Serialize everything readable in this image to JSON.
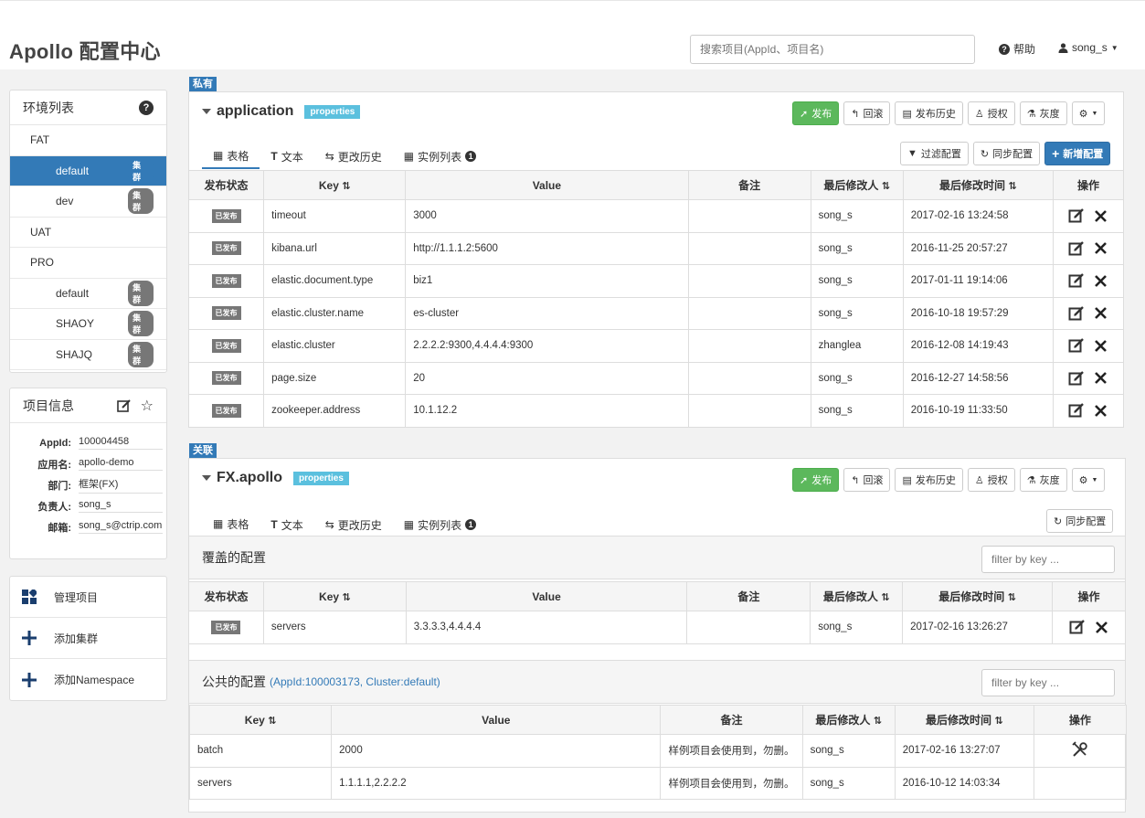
{
  "header": {
    "brand": "Apollo 配置中心",
    "search_placeholder": "搜索项目(AppId、项目名)",
    "help": "帮助",
    "user": "song_s"
  },
  "env_panel": {
    "title": "环境列表",
    "items": [
      {
        "type": "env",
        "label": "FAT"
      },
      {
        "type": "cluster",
        "label": "default",
        "badge": "集群",
        "active": true
      },
      {
        "type": "cluster",
        "label": "dev",
        "badge": "集群"
      },
      {
        "type": "env",
        "label": "UAT"
      },
      {
        "type": "env",
        "label": "PRO"
      },
      {
        "type": "cluster",
        "label": "default",
        "badge": "集群"
      },
      {
        "type": "cluster",
        "label": "SHAOY",
        "badge": "集群"
      },
      {
        "type": "cluster",
        "label": "SHAJQ",
        "badge": "集群"
      }
    ]
  },
  "project_panel": {
    "title": "项目信息",
    "rows": [
      {
        "label": "AppId:",
        "value": "100004458"
      },
      {
        "label": "应用名:",
        "value": "apollo-demo"
      },
      {
        "label": "部门:",
        "value": "框架(FX)"
      },
      {
        "label": "负责人:",
        "value": "song_s"
      },
      {
        "label": "邮箱:",
        "value": "song_s@ctrip.com"
      }
    ]
  },
  "actions": [
    {
      "label": "管理项目",
      "icon": "grid-icon"
    },
    {
      "label": "添加集群",
      "icon": "plus-icon"
    },
    {
      "label": "添加Namespace",
      "icon": "plus-icon"
    }
  ],
  "ns1": {
    "tag": "私有",
    "title": "application",
    "format": "properties",
    "buttons": {
      "publish": "发布",
      "rollback": "回滚",
      "history": "发布历史",
      "auth": "授权",
      "gray": "灰度"
    },
    "tabs": [
      "表格",
      "文本",
      "更改历史",
      "实例列表"
    ],
    "instance_count": "1",
    "right_buttons": {
      "filter": "过滤配置",
      "sync": "同步配置",
      "add": "新增配置"
    },
    "columns": [
      "发布状态",
      "Key",
      "Value",
      "备注",
      "最后修改人",
      "最后修改时间",
      "操作"
    ],
    "rows": [
      {
        "status": "已发布",
        "key": "timeout",
        "value": "3000",
        "comment": "",
        "modifier": "song_s",
        "time": "2017-02-16 13:24:58"
      },
      {
        "status": "已发布",
        "key": "kibana.url",
        "value": "http://1.1.1.2:5600",
        "comment": "",
        "modifier": "song_s",
        "time": "2016-11-25 20:57:27"
      },
      {
        "status": "已发布",
        "key": "elastic.document.type",
        "value": "biz1",
        "comment": "",
        "modifier": "song_s",
        "time": "2017-01-11 19:14:06"
      },
      {
        "status": "已发布",
        "key": "elastic.cluster.name",
        "value": "es-cluster",
        "comment": "",
        "modifier": "song_s",
        "time": "2016-10-18 19:57:29"
      },
      {
        "status": "已发布",
        "key": "elastic.cluster",
        "value": "2.2.2.2:9300,4.4.4.4:9300",
        "comment": "",
        "modifier": "zhanglea",
        "time": "2016-12-08 14:19:43"
      },
      {
        "status": "已发布",
        "key": "page.size",
        "value": "20",
        "comment": "",
        "modifier": "song_s",
        "time": "2016-12-27 14:58:56"
      },
      {
        "status": "已发布",
        "key": "zookeeper.address",
        "value": "10.1.12.2",
        "comment": "",
        "modifier": "song_s",
        "time": "2016-10-19 11:33:50"
      }
    ]
  },
  "ns2": {
    "tag": "关联",
    "title": "FX.apollo",
    "format": "properties",
    "buttons": {
      "publish": "发布",
      "rollback": "回滚",
      "history": "发布历史",
      "auth": "授权",
      "gray": "灰度"
    },
    "tabs": [
      "表格",
      "文本",
      "更改历史",
      "实例列表"
    ],
    "instance_count": "1",
    "sync": "同步配置",
    "override_title": "覆盖的配置",
    "filter_placeholder": "filter by key ...",
    "override_columns": [
      "发布状态",
      "Key",
      "Value",
      "备注",
      "最后修改人",
      "最后修改时间",
      "操作"
    ],
    "override_rows": [
      {
        "status": "已发布",
        "key": "servers",
        "value": "3.3.3.3,4.4.4.4",
        "comment": "",
        "modifier": "song_s",
        "time": "2017-02-16 13:26:27"
      }
    ],
    "public_title": "公共的配置",
    "public_link": "(AppId:100003173, Cluster:default)",
    "public_columns": [
      "Key",
      "Value",
      "备注",
      "最后修改人",
      "最后修改时间",
      "操作"
    ],
    "public_rows": [
      {
        "key": "batch",
        "value": "2000",
        "comment": "样例项目会使用到，勿删。",
        "modifier": "song_s",
        "time": "2017-02-16 13:27:07",
        "has_op": true
      },
      {
        "key": "servers",
        "value": "1.1.1.1,2.2.2.2",
        "comment": "样例项目会使用到，勿删。",
        "modifier": "song_s",
        "time": "2016-10-12 14:03:34",
        "has_op": false
      }
    ]
  },
  "colors": {
    "primary": "#337ab7",
    "success": "#5cb85c",
    "info": "#5bc0de",
    "badge": "#777777"
  }
}
